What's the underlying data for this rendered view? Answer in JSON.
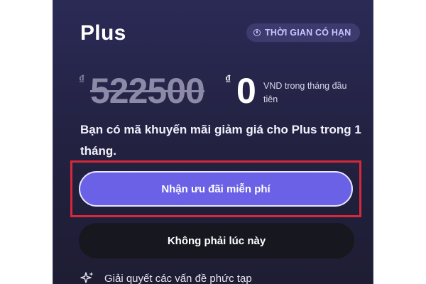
{
  "plan": {
    "name": "Plus",
    "badge_label": "THỜI GIAN CÓ HẠN",
    "badge_icon": "clock-icon"
  },
  "pricing": {
    "currency_symbol": "₫",
    "original_price": "522500",
    "promo_price": "0",
    "price_note": "VND trong tháng đầu tiên"
  },
  "promo": {
    "message": "Bạn có mã khuyến mãi giảm giá cho Plus trong 1 tháng."
  },
  "actions": {
    "claim_label": "Nhận ưu đãi miễn phí",
    "dismiss_label": "Không phải lúc này"
  },
  "features": [
    {
      "icon": "sparkle-icon",
      "label": "Giải quyết các vấn đề phức tạp"
    }
  ],
  "colors": {
    "card_background": "#26254a",
    "primary_button": "#6b61e6",
    "secondary_button": "#17171f",
    "badge_background": "#3d3a6e",
    "highlight_border": "#d6283a"
  }
}
